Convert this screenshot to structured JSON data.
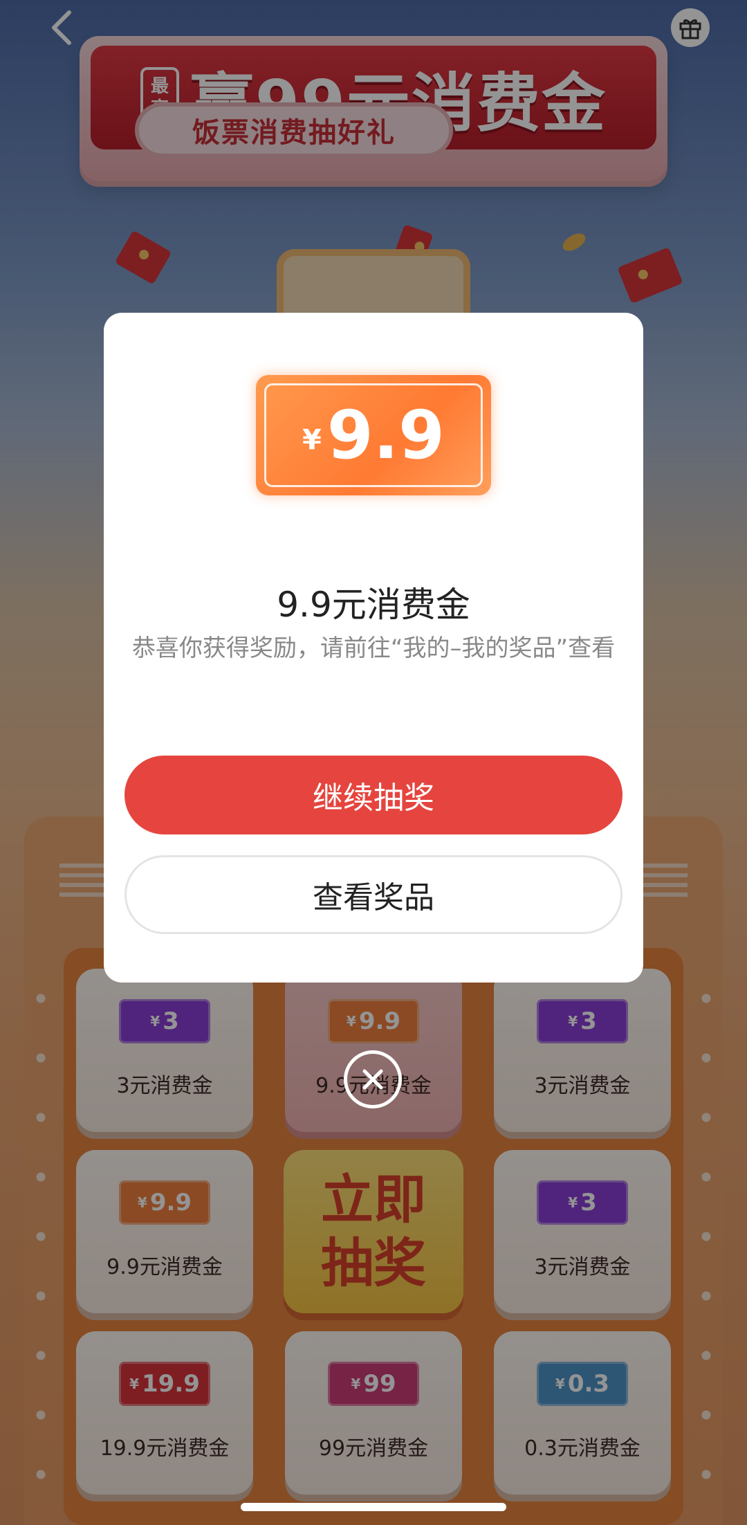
{
  "header": {
    "back_icon": "chevron-left-icon",
    "gift_icon": "gift-icon"
  },
  "banner": {
    "tag_line1": "最",
    "tag_line2": "高",
    "title": "赢99元消费金",
    "subtitle": "饭票消费抽好礼"
  },
  "grid": {
    "cells": [
      {
        "amount": "3",
        "label": "3元消费金",
        "color": "#8b3fd6"
      },
      {
        "amount": "9.9",
        "label": "9.9元消费金",
        "color": "#f0803f"
      },
      {
        "amount": "3",
        "label": "3元消费金",
        "color": "#8b3fd6"
      },
      {
        "amount": "9.9",
        "label": "9.9元消费金",
        "color": "#f0803f"
      },
      {
        "amount": "3",
        "label": "3元消费金",
        "color": "#8b3fd6"
      },
      {
        "amount": "19.9",
        "label": "19.9元消费金",
        "color": "#d9343d"
      },
      {
        "amount": "99",
        "label": "99元消费金",
        "color": "#cc3d78"
      },
      {
        "amount": "0.3",
        "label": "0.3元消费金",
        "color": "#4f95c9"
      }
    ],
    "draw_button": "立即抽奖",
    "yen_symbol": "¥"
  },
  "modal": {
    "ticket_yen": "¥",
    "ticket_amount": "9.9",
    "title": "9.9元消费金",
    "message": "恭喜你获得奖励，请前往“我的–我的奖品”查看",
    "continue_button": "继续抽奖",
    "view_button": "查看奖品",
    "close_icon": "close-icon",
    "primary_color": "#e5453e"
  }
}
